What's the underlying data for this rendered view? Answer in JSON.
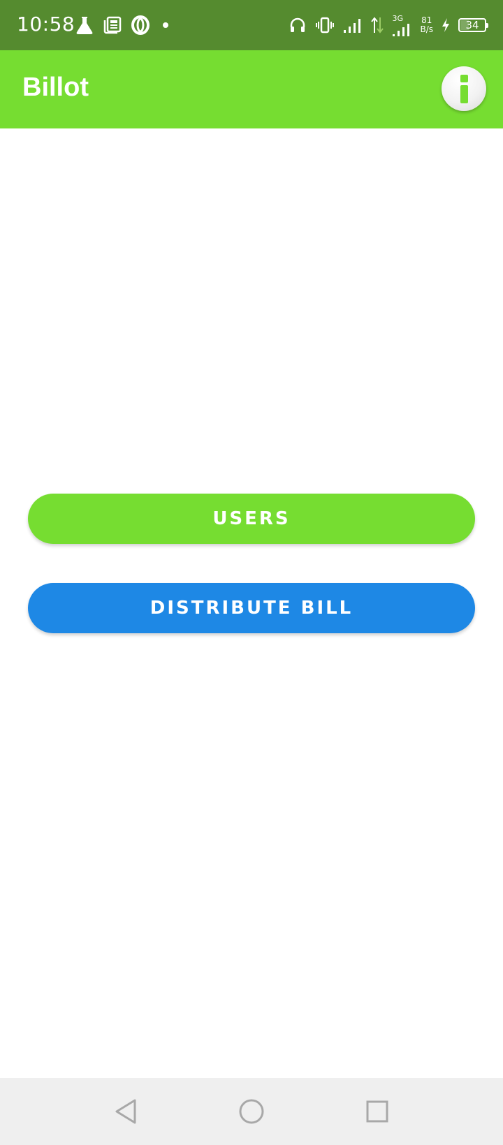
{
  "status_bar": {
    "time": "10:58",
    "network_type": "3G",
    "net_speed_value": "81",
    "net_speed_unit": "B/s",
    "battery_level": "34",
    "left_icons": [
      "flask-icon",
      "news-icon",
      "opera-icon",
      "dot-icon"
    ],
    "right_icons": [
      "headset-icon",
      "vibrate-icon",
      "signal-icon",
      "data-arrows-icon",
      "signal-3g-icon",
      "charging-icon",
      "battery-icon"
    ]
  },
  "app_bar": {
    "title": "Billot",
    "info_icon": "info-icon"
  },
  "main": {
    "users_label": "USERS",
    "distribute_label": "DISTRIBUTE BILL"
  },
  "nav_bar": {
    "icons": [
      "back-icon",
      "home-icon",
      "recents-icon"
    ]
  },
  "colors": {
    "status_bar": "#558b2f",
    "app_bar": "#76dd31",
    "users_button": "#76dd31",
    "distribute_button": "#1e88e5",
    "nav_bar": "#efefef"
  }
}
